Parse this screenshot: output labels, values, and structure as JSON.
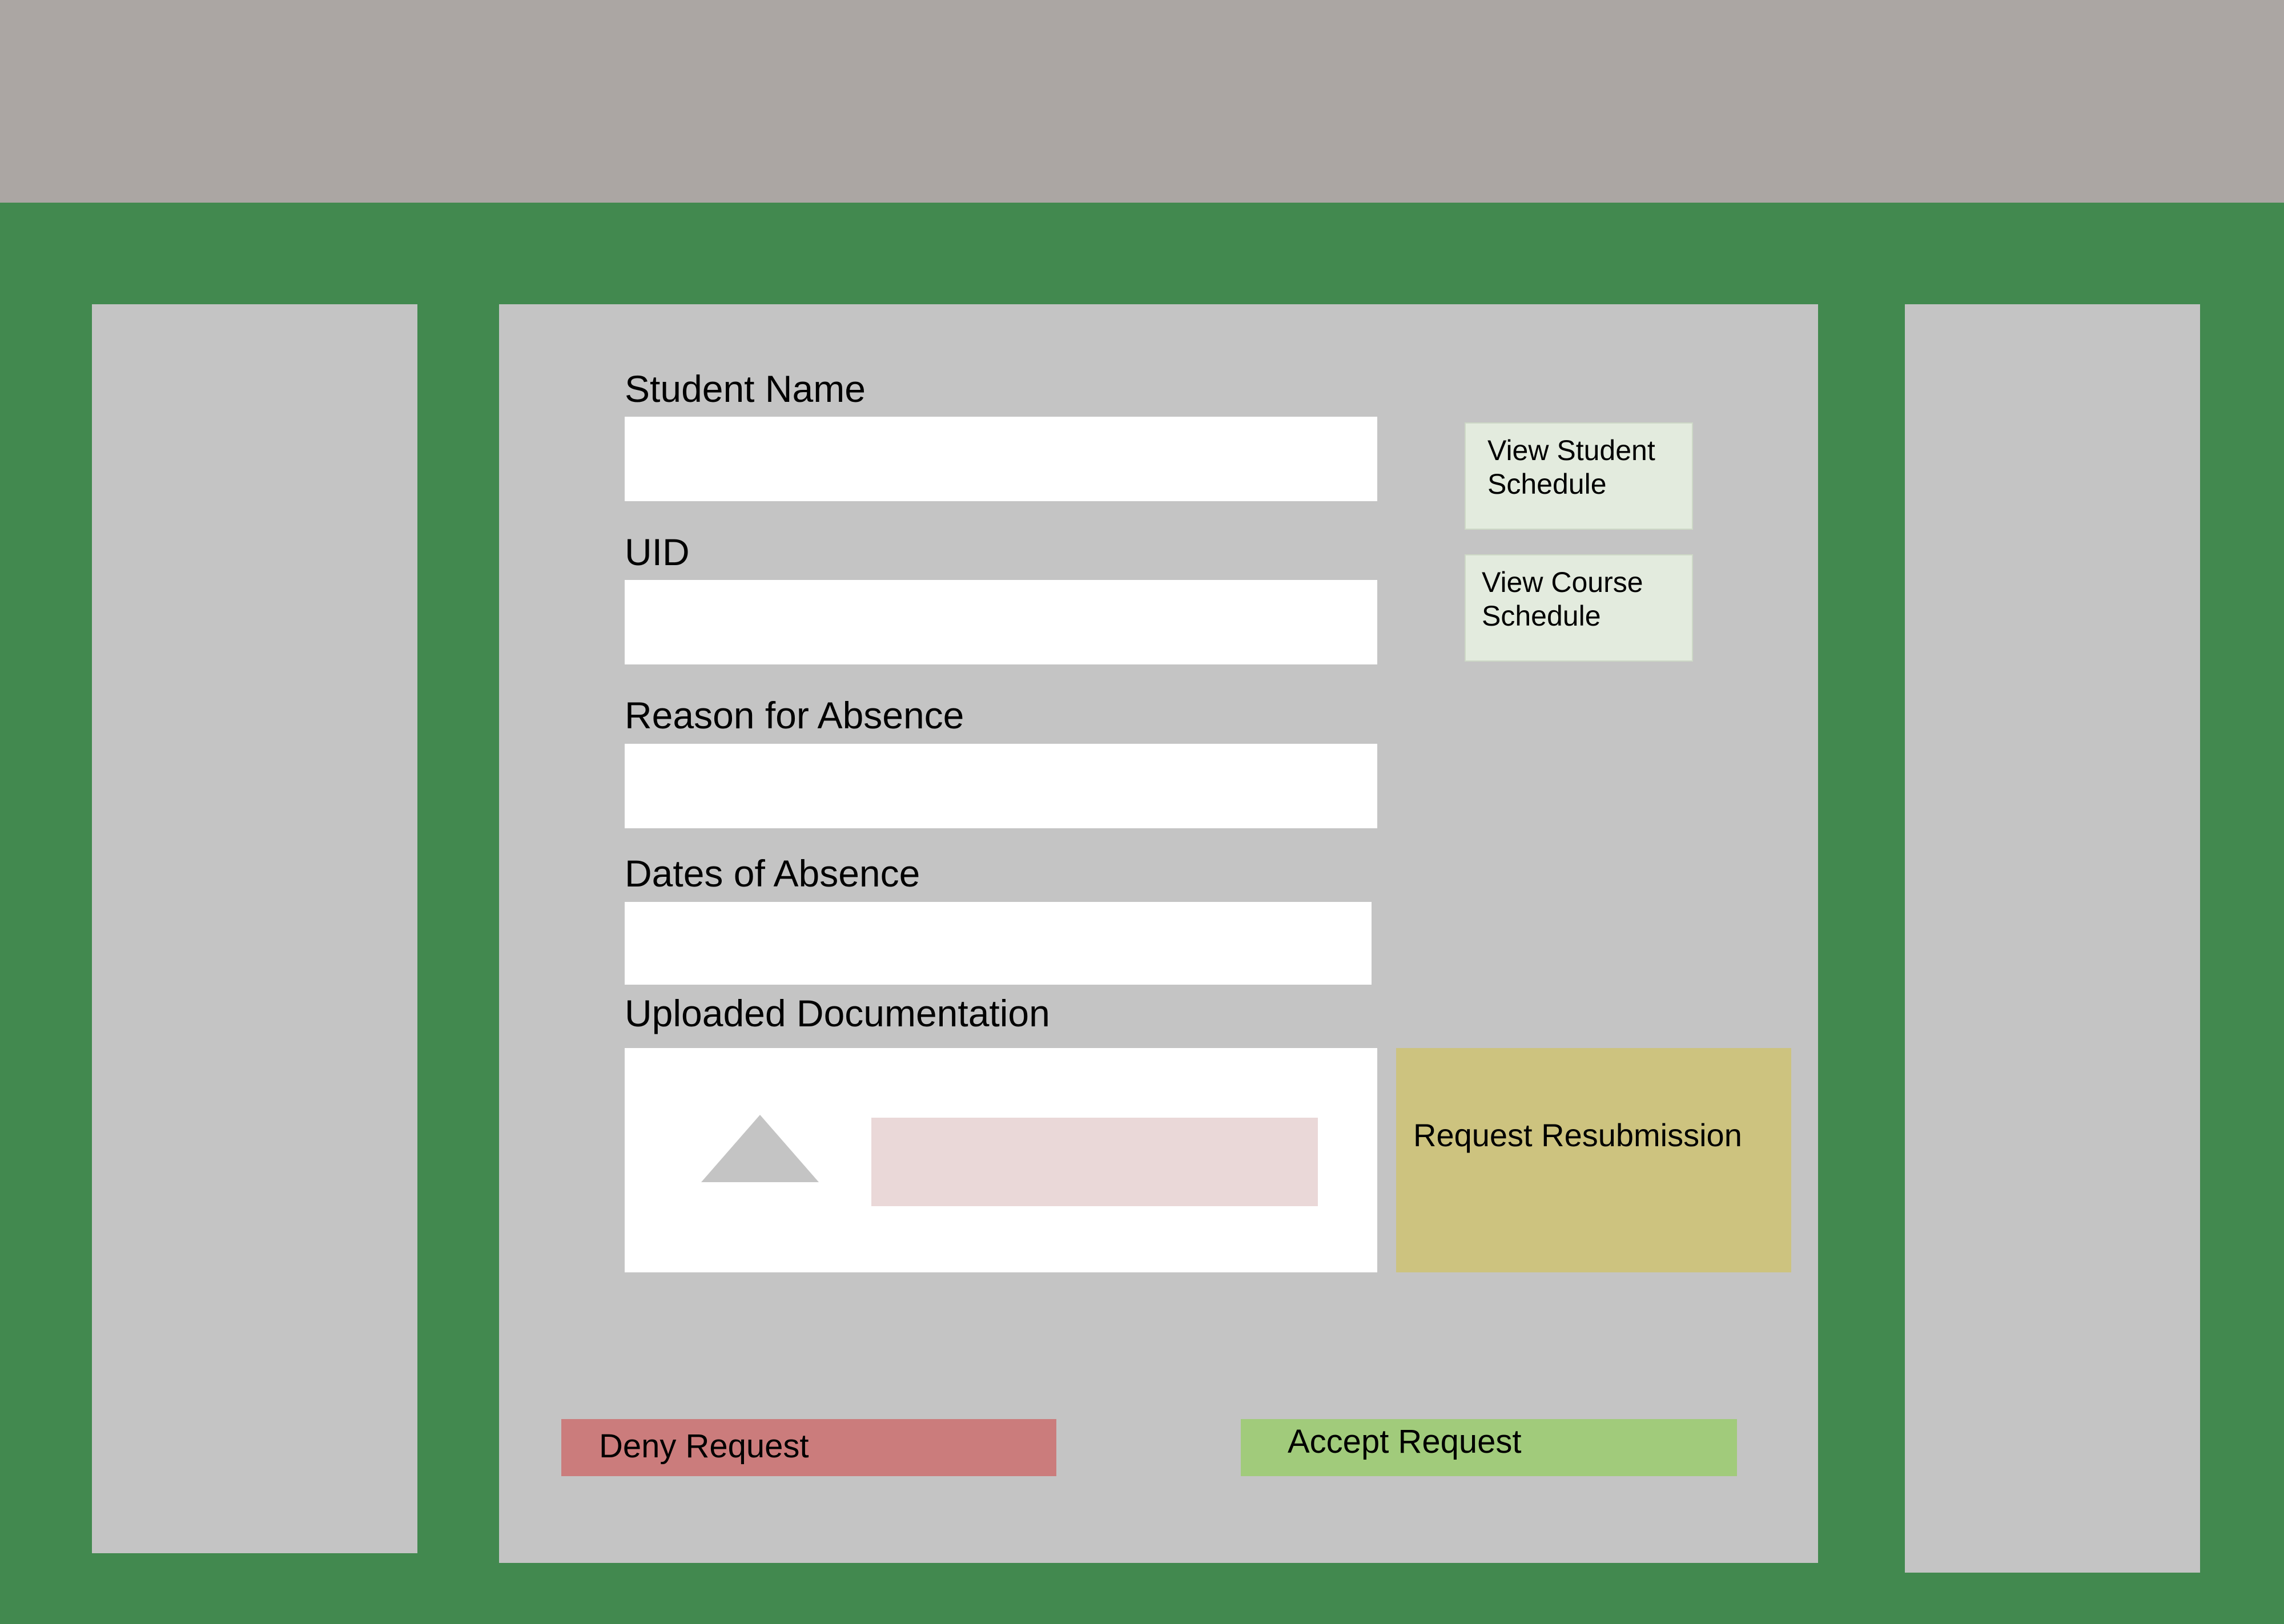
{
  "form": {
    "student_name": {
      "label": "Student Name",
      "value": "",
      "placeholder": ""
    },
    "uid": {
      "label": "UID",
      "value": "",
      "placeholder": ""
    },
    "reason": {
      "label": "Reason for Absence",
      "value": "",
      "placeholder": ""
    },
    "dates": {
      "label": "Dates of Absence",
      "value": "",
      "placeholder": ""
    },
    "documentation": {
      "label": "Uploaded Documentation",
      "icon": "document-thumbnail-icon"
    }
  },
  "actions": {
    "view_student_schedule": "View Student\nSchedule",
    "view_course_schedule": "View Course\nSchedule",
    "request_resubmission": "Request Resubmission",
    "deny_request": "Deny Request",
    "accept_request": "Accept Request"
  },
  "colors": {
    "header": "#aba6a3",
    "background": "#42894f",
    "panel": "#c4c4c4",
    "schedule_button": "#e3ebde",
    "resubmit": "#cdc37f",
    "deny": "#cb7c7c",
    "accept": "#a1cb7b",
    "file_bar": "#ead8d8"
  }
}
